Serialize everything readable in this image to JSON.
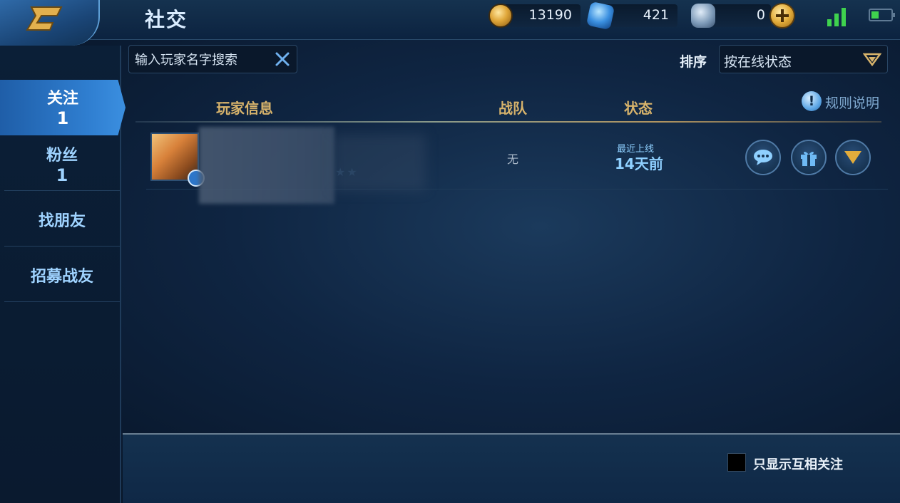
{
  "header": {
    "title": "社交",
    "gold": "13190",
    "diamonds": "421",
    "vouchers": "0"
  },
  "search": {
    "placeholder": "输入玩家名字搜索"
  },
  "sort": {
    "label": "排序",
    "selected": "按在线状态"
  },
  "sidebar": {
    "items": [
      {
        "label": "关注",
        "count": "1"
      },
      {
        "label": "粉丝",
        "count": "1"
      },
      {
        "label": "找朋友"
      },
      {
        "label": "招募战友"
      }
    ]
  },
  "table": {
    "columns": [
      "玩家信息",
      "战队",
      "状态"
    ],
    "rules_label": "规则说明",
    "rows": [
      {
        "stars": "★★",
        "team": "无",
        "status_label": "最近上线",
        "status_value": "14天前"
      }
    ]
  },
  "footer": {
    "mutual_only_label": "只显示互相关注"
  },
  "colors": {
    "accent": "#3b8fe0",
    "gold_header": "#d7b36b",
    "status": "#8fd0ff",
    "signal": "#3fd24e"
  },
  "icons": [
    "back-icon",
    "gold-coin-icon",
    "diamond-icon",
    "voucher-icon",
    "plus-icon",
    "signal-icon",
    "battery-icon",
    "clear-icon",
    "dropdown-icon",
    "info-icon",
    "chat-icon",
    "gift-icon",
    "more-icon"
  ]
}
